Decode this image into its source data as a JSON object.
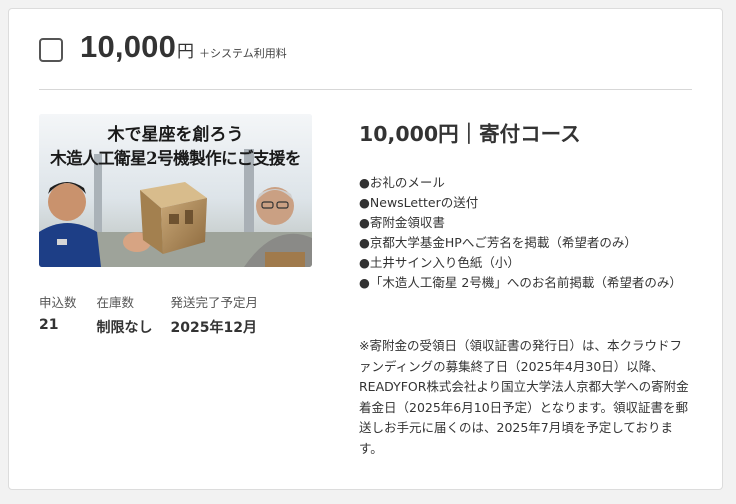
{
  "option": {
    "price_amount": "10,000",
    "price_unit": "円",
    "fee_note": "＋システム利用料"
  },
  "hero": {
    "title_line1": "木で星座を創ろう",
    "title_line2": "木造人工衛星2号機製作にご支援を"
  },
  "stats": [
    {
      "label": "申込数",
      "value": "21"
    },
    {
      "label": "在庫数",
      "value": "制限なし"
    },
    {
      "label": "発送完了予定月",
      "value": "2025年12月"
    }
  ],
  "course": {
    "title": "10,000円｜寄付コース",
    "rewards": [
      "●お礼のメール",
      "●NewsLetterの送付",
      "●寄附金領収書",
      "●京都大学基金HPへご芳名を掲載（希望者のみ）",
      "●土井サイン入り色紙（小）",
      "●「木造人工衛星 2号機」へのお名前掲載（希望者のみ）"
    ],
    "note": "※寄附金の受領日（領収証書の発行日）は、本クラウドファンディングの募集終了日（2025年4月30日）以降、READYFOR株式会社より国立大学法人京都大学への寄附金着金日（2025年6月10日予定）となります。領収証書を郵送しお手元に届くのは、2025年7月頃を予定しております。"
  }
}
